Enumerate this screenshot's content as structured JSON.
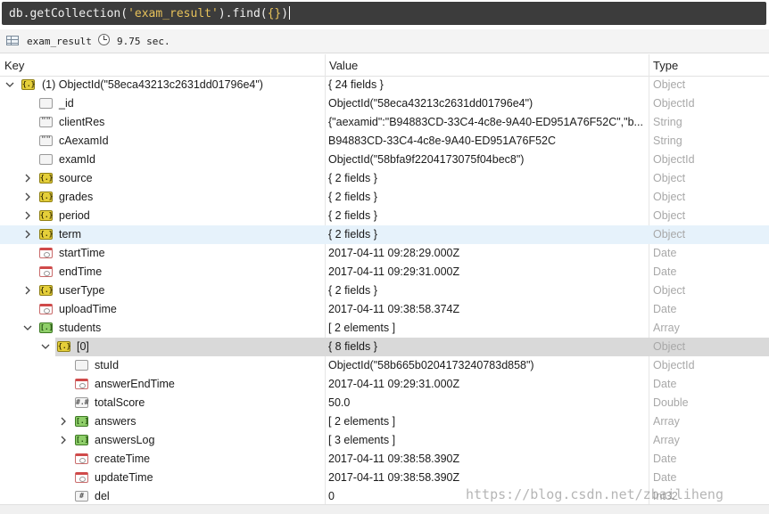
{
  "query": {
    "prefix": "db.getCollection(",
    "collection_arg": "'exam_result'",
    "middle": ").find(",
    "arg": "{}",
    "suffix": ")"
  },
  "info": {
    "collection": "exam_result",
    "time": "9.75 sec."
  },
  "columns": {
    "key": "Key",
    "value": "Value",
    "type": "Type"
  },
  "rows": [
    {
      "key": "(1) ObjectId(\"58eca43213c2631dd01796e4\")",
      "value": "{ 24 fields }",
      "type": "Object"
    },
    {
      "key": "_id",
      "value": "ObjectId(\"58eca43213c2631dd01796e4\")",
      "type": "ObjectId"
    },
    {
      "key": "clientRes",
      "value": "{\"aexamid\":\"B94883CD-33C4-4c8e-9A40-ED951A76F52C\",\"b...",
      "type": "String"
    },
    {
      "key": "cAexamId",
      "value": "B94883CD-33C4-4c8e-9A40-ED951A76F52C",
      "type": "String"
    },
    {
      "key": "examId",
      "value": "ObjectId(\"58bfa9f2204173075f04bec8\")",
      "type": "ObjectId"
    },
    {
      "key": "source",
      "value": "{ 2 fields }",
      "type": "Object"
    },
    {
      "key": "grades",
      "value": "{ 2 fields }",
      "type": "Object"
    },
    {
      "key": "period",
      "value": "{ 2 fields }",
      "type": "Object"
    },
    {
      "key": "term",
      "value": "{ 2 fields }",
      "type": "Object"
    },
    {
      "key": "startTime",
      "value": "2017-04-11 09:28:29.000Z",
      "type": "Date"
    },
    {
      "key": "endTime",
      "value": "2017-04-11 09:29:31.000Z",
      "type": "Date"
    },
    {
      "key": "userType",
      "value": "{ 2 fields }",
      "type": "Object"
    },
    {
      "key": "uploadTime",
      "value": "2017-04-11 09:38:58.374Z",
      "type": "Date"
    },
    {
      "key": "students",
      "value": "[ 2 elements ]",
      "type": "Array"
    },
    {
      "key": "[0]",
      "value": "{ 8 fields }",
      "type": "Object"
    },
    {
      "key": "stuId",
      "value": "ObjectId(\"58b665b0204173240783d858\")",
      "type": "ObjectId"
    },
    {
      "key": "answerEndTime",
      "value": "2017-04-11 09:29:31.000Z",
      "type": "Date"
    },
    {
      "key": "totalScore",
      "value": "50.0",
      "type": "Double"
    },
    {
      "key": "answers",
      "value": "[ 2 elements ]",
      "type": "Array"
    },
    {
      "key": "answersLog",
      "value": "[ 3 elements ]",
      "type": "Array"
    },
    {
      "key": "createTime",
      "value": "2017-04-11 09:38:58.390Z",
      "type": "Date"
    },
    {
      "key": "updateTime",
      "value": "2017-04-11 09:38:58.390Z",
      "type": "Date"
    },
    {
      "key": "del",
      "value": "0",
      "type": "Int32"
    }
  ],
  "icon_glyphs": {
    "object": "{.}",
    "array": "[.]",
    "string": "\"\"",
    "double": "#.#",
    "int": "#"
  },
  "watermark": "https://blog.csdn.net/zbailiheng"
}
